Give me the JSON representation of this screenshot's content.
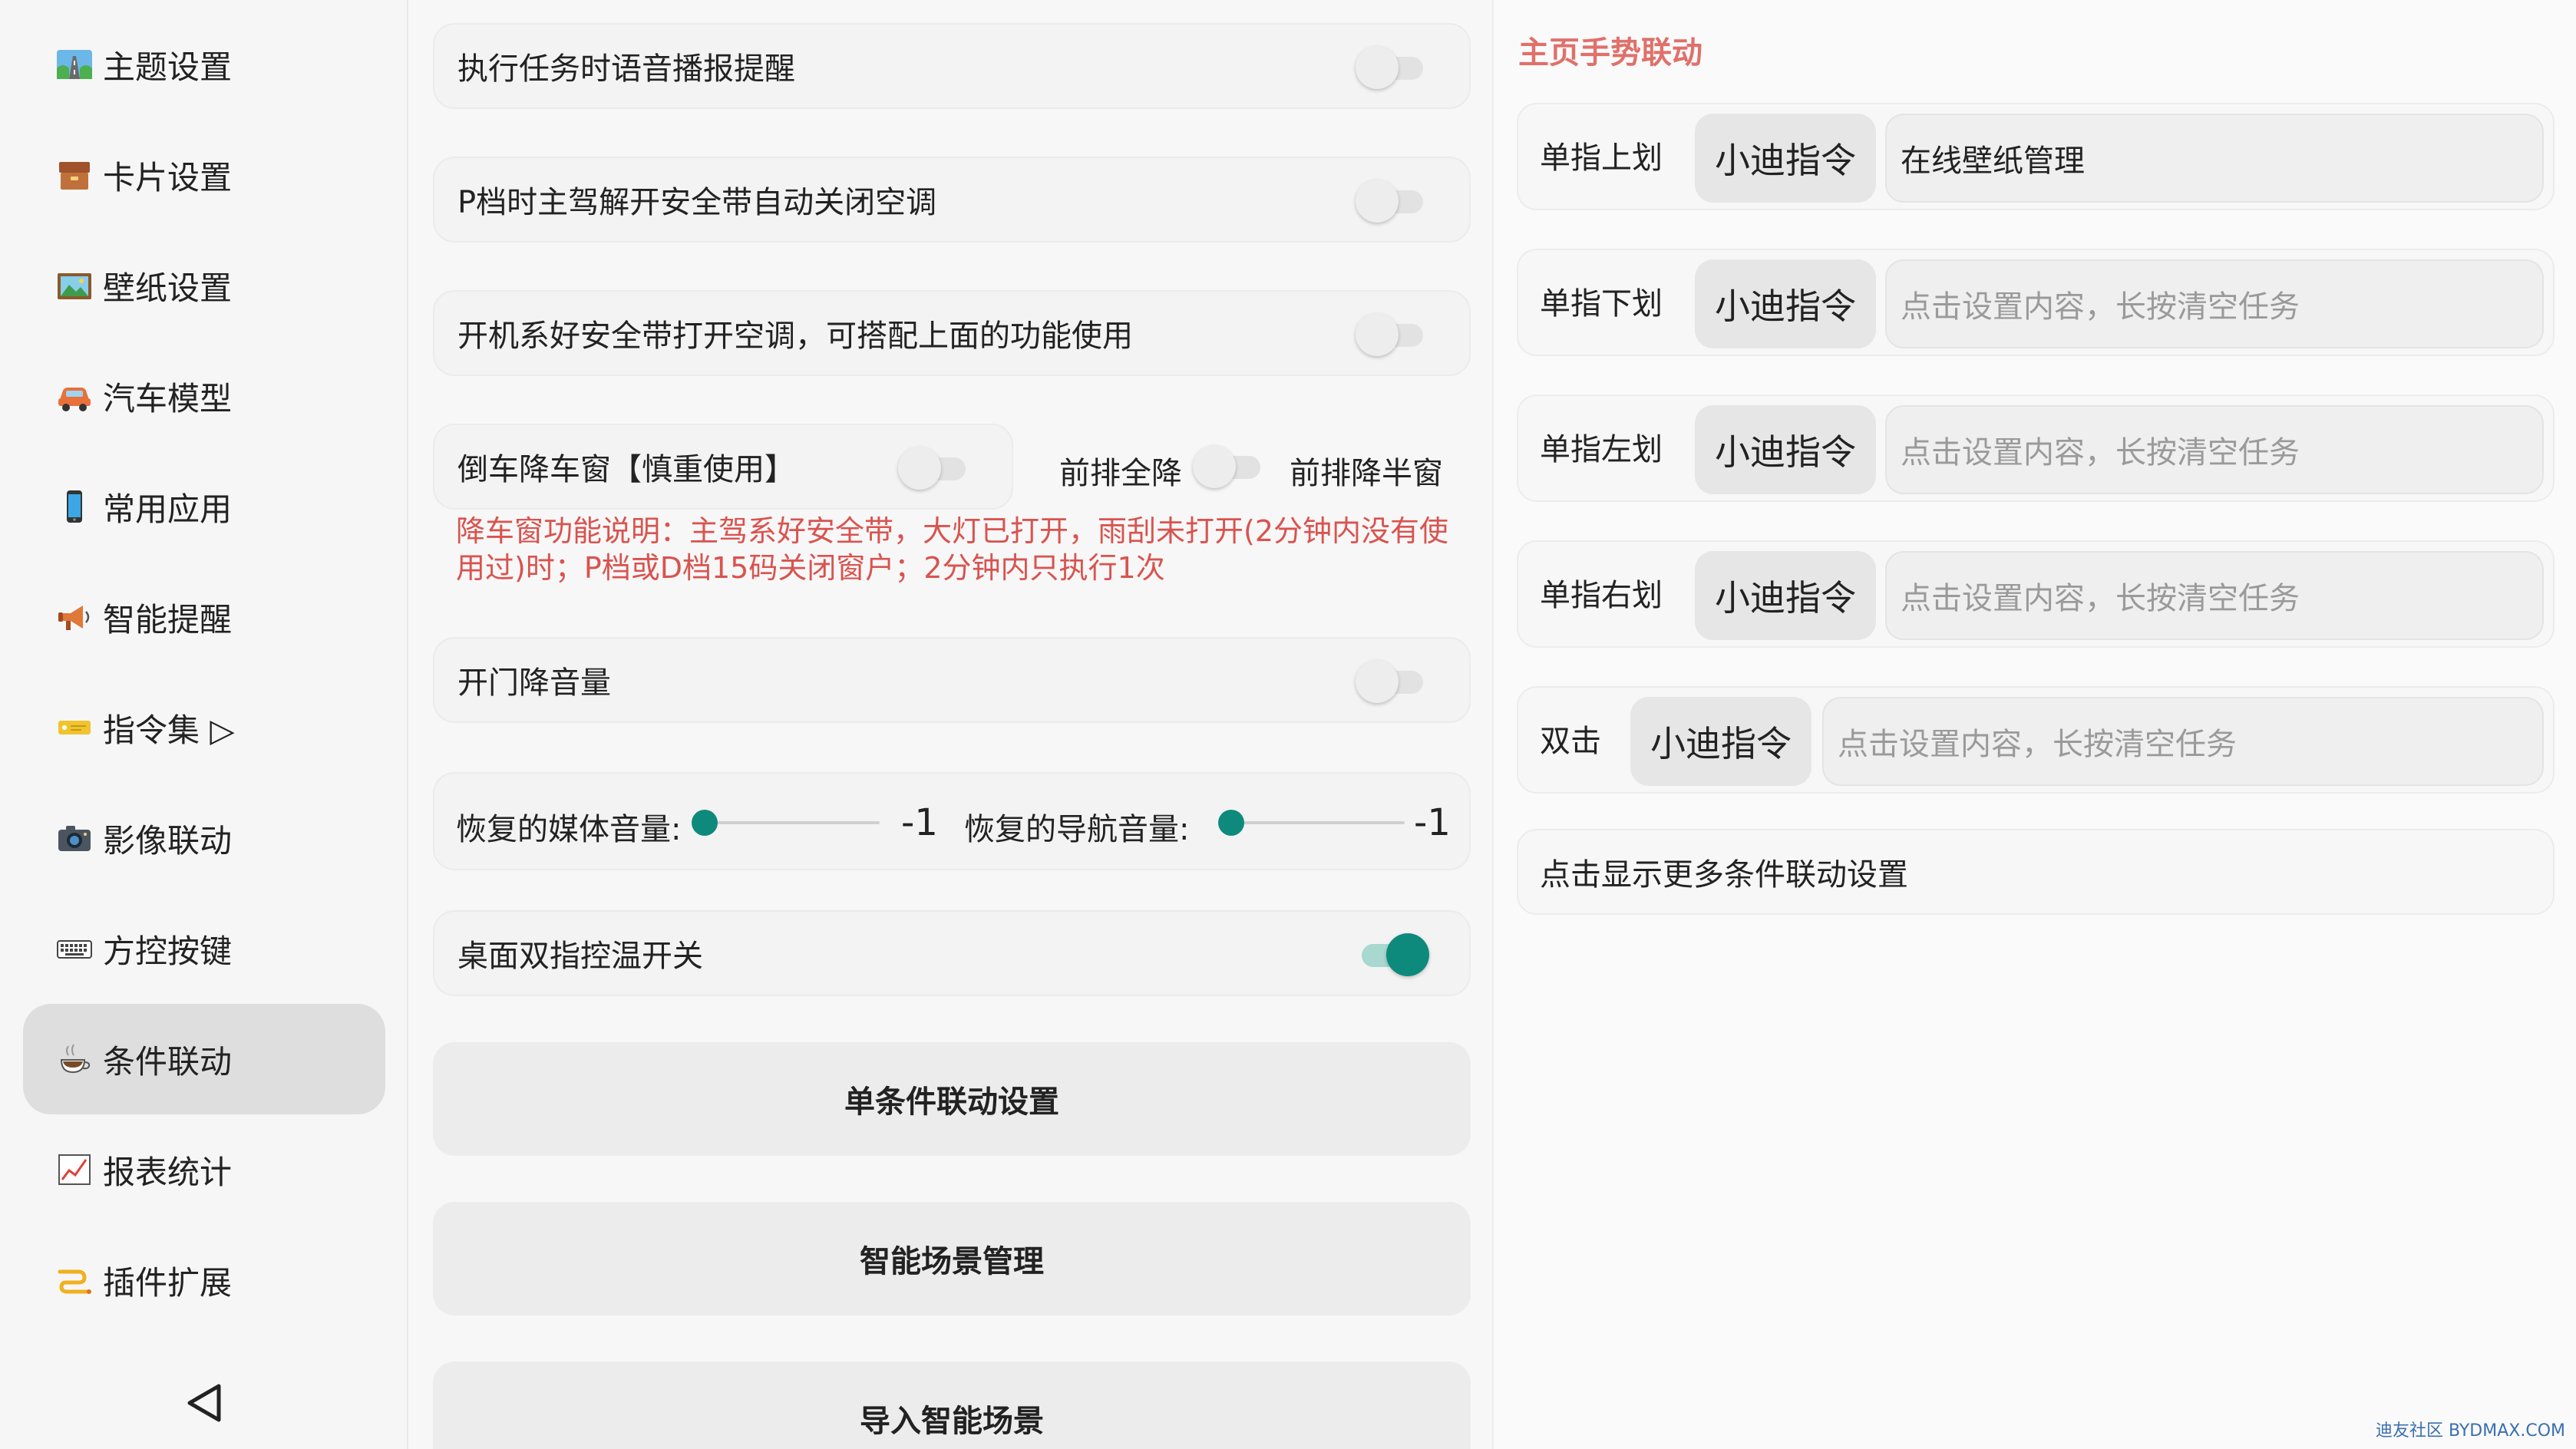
{
  "sidebar": {
    "items": [
      {
        "label": "主题设置",
        "icon": "road-icon"
      },
      {
        "label": "卡片设置",
        "icon": "box-icon"
      },
      {
        "label": "壁纸设置",
        "icon": "picture-icon"
      },
      {
        "label": "汽车模型",
        "icon": "car-icon"
      },
      {
        "label": "常用应用",
        "icon": "phone-icon"
      },
      {
        "label": "智能提醒",
        "icon": "megaphone-icon"
      },
      {
        "label": "指令集 ▷",
        "icon": "ticket-icon"
      },
      {
        "label": "影像联动",
        "icon": "camera-icon"
      },
      {
        "label": "方控按键",
        "icon": "keyboard-icon"
      },
      {
        "label": "条件联动",
        "icon": "coffee-icon",
        "active": true
      },
      {
        "label": "报表统计",
        "icon": "chart-icon"
      },
      {
        "label": "插件扩展",
        "icon": "plugin-icon"
      }
    ]
  },
  "middle": {
    "toggles": [
      {
        "label": "执行任务时语音播报提醒",
        "on": false
      },
      {
        "label": "P档时主驾解开安全带自动关闭空调",
        "on": false
      },
      {
        "label": "开机系好安全带打开空调，可搭配上面的功能使用",
        "on": false
      }
    ],
    "reverse_window": {
      "label": "倒车降车窗【慎重使用】",
      "front_full_label": "前排全降",
      "front_half_label": "前排降半窗",
      "description": "降车窗功能说明：主驾系好安全带，大灯已打开，雨刮未打开(2分钟内没有使用过)时；P档或D档15码关闭窗户；2分钟内只执行1次"
    },
    "door_volume": {
      "label": "开门降音量",
      "on": false
    },
    "volume": {
      "media_label": "恢复的媒体音量:",
      "media_value": "-1",
      "media_level": 0,
      "nav_label": "恢复的导航音量:",
      "nav_value": "-1",
      "nav_level": 0
    },
    "temp_control": {
      "label": "桌面双指控温开关",
      "on": true
    },
    "buttons": {
      "single_condition": "单条件联动设置",
      "scene_manage": "智能场景管理",
      "import_scene": "导入智能场景"
    }
  },
  "right": {
    "title": "主页手势联动",
    "gestures": [
      {
        "label": "单指上划",
        "cmd": "小迪指令",
        "value": "在线壁纸管理",
        "placeholder": false
      },
      {
        "label": "单指下划",
        "cmd": "小迪指令",
        "value": "点击设置内容，长按清空任务",
        "placeholder": true
      },
      {
        "label": "单指左划",
        "cmd": "小迪指令",
        "value": "点击设置内容，长按清空任务",
        "placeholder": true
      },
      {
        "label": "单指右划",
        "cmd": "小迪指令",
        "value": "点击设置内容，长按清空任务",
        "placeholder": true
      },
      {
        "label": "双击",
        "cmd": "小迪指令",
        "value": "点击设置内容，长按清空任务",
        "placeholder": true
      }
    ],
    "more": "点击显示更多条件联动设置"
  },
  "watermark": "迪友社区 BYDMAX.COM",
  "colors": {
    "accent": "#0e8a7c",
    "warning": "#d9534f",
    "title": "#e0706a"
  }
}
